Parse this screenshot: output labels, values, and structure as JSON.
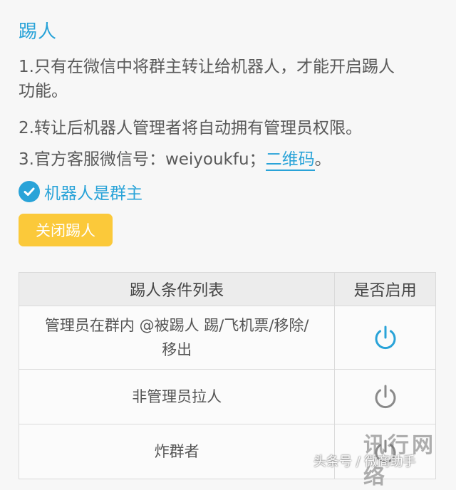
{
  "section": {
    "title": "踢人",
    "line1a": "1.只有在微信中将群主转让给机器人，才能开启踢人",
    "line1b": "功能。",
    "line2": "2.转让后机器人管理者将自动拥有管理员权限。",
    "line3_prefix": "3.官方客服微信号：weiyoukfu；",
    "line3_link": "二维码",
    "line3_suffix": "。"
  },
  "status": {
    "label": "机器人是群主",
    "icon": "check-circle-icon",
    "color": "#29a3d8"
  },
  "kick_button": {
    "label": "关闭踢人",
    "color": "#fbc93a"
  },
  "table": {
    "headers": [
      "踢人条件列表",
      "是否启用"
    ],
    "rows": [
      {
        "condition_a": "管理员在群内 @被踢人 踢/飞机票/移除/",
        "condition_b": "移出",
        "enabled": true
      },
      {
        "condition": "非管理员拉人",
        "enabled": false
      },
      {
        "condition": "炸群者",
        "enabled": false
      }
    ],
    "active_color": "#29a3d8",
    "inactive_color": "#8a8a8a"
  },
  "watermark": {
    "brand": "讯行网络",
    "source": "头条号 / 微商助手"
  }
}
